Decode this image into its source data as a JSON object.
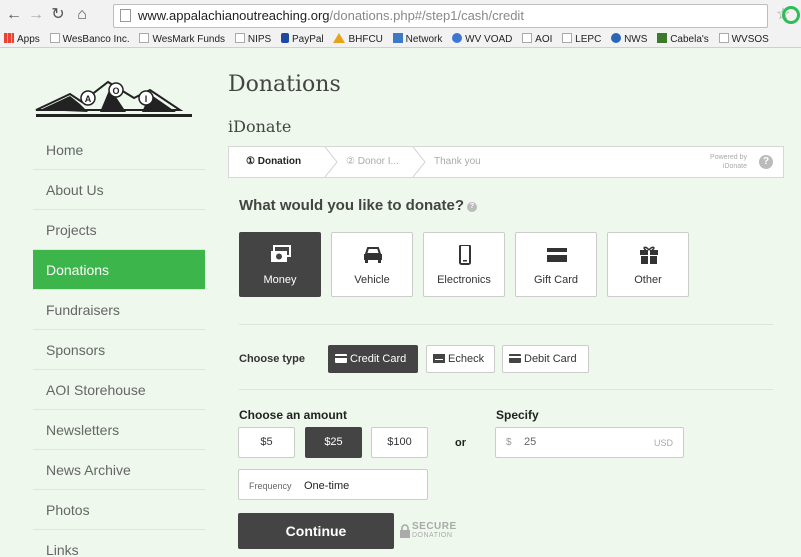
{
  "browser": {
    "url_domain": "www.appalachianoutreaching.org",
    "url_path": "/donations.php#/step1/cash/credit",
    "bookmarks": [
      "Apps",
      "WesBanco Inc.",
      "WesMark Funds",
      "NIPS",
      "PayPal",
      "BHFCU",
      "Network",
      "WV VOAD",
      "AOI",
      "LEPC",
      "NWS",
      "Cabela's",
      "WVSOS"
    ]
  },
  "logo": {
    "letters": [
      "A",
      "O",
      "I"
    ]
  },
  "sidebar": {
    "items": [
      {
        "label": "Home",
        "active": false
      },
      {
        "label": "About Us",
        "active": false
      },
      {
        "label": "Projects",
        "active": false
      },
      {
        "label": "Donations",
        "active": true
      },
      {
        "label": "Fundraisers",
        "active": false
      },
      {
        "label": "Sponsors",
        "active": false
      },
      {
        "label": "AOI Storehouse",
        "active": false
      },
      {
        "label": "Newsletters",
        "active": false
      },
      {
        "label": "News Archive",
        "active": false
      },
      {
        "label": "Photos",
        "active": false
      },
      {
        "label": "Links",
        "active": false
      }
    ]
  },
  "main": {
    "title": "Donations",
    "subtitle": "iDonate",
    "steps": [
      "① Donation",
      "② Donor I...",
      "Thank you"
    ],
    "powered_by": [
      "Powered by",
      "iDonate"
    ],
    "question": "What would you like to donate?",
    "donation_types": [
      {
        "label": "Money",
        "selected": true
      },
      {
        "label": "Vehicle",
        "selected": false
      },
      {
        "label": "Electronics",
        "selected": false
      },
      {
        "label": "Gift Card",
        "selected": false
      },
      {
        "label": "Other",
        "selected": false
      }
    ],
    "choose_type_label": "Choose type",
    "card_types": [
      {
        "label": "Credit Card",
        "selected": true
      },
      {
        "label": "Echeck",
        "selected": false
      },
      {
        "label": "Debit Card",
        "selected": false
      }
    ],
    "amount_label": "Choose an amount",
    "amounts": [
      {
        "label": "$5",
        "selected": false
      },
      {
        "label": "$25",
        "selected": true
      },
      {
        "label": "$100",
        "selected": false
      }
    ],
    "or_label": "or",
    "specify_label": "Specify",
    "specify": {
      "currency_symbol": "$",
      "value": "25",
      "unit": "USD"
    },
    "frequency": {
      "label": "Frequency",
      "value": "One-time"
    },
    "continue_label": "Continue",
    "secure": {
      "line1": "SECURE",
      "line2": "DONATION"
    }
  },
  "colors": {
    "accent_green": "#3cb54a",
    "dark_button": "#444444",
    "page_background": "#eef8ec"
  }
}
